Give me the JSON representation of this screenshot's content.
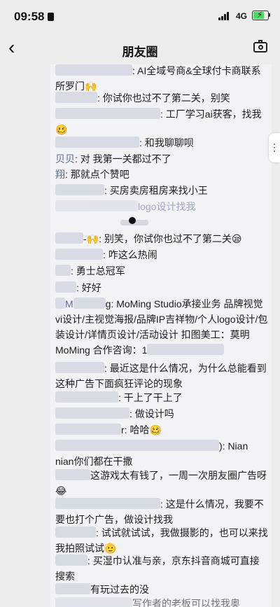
{
  "status_bar": {
    "time": "09:58",
    "network": "4G"
  },
  "nav": {
    "back_icon": "chevron-left",
    "title": "朋友圈",
    "camera_icon": "camera"
  },
  "comments": [
    {
      "author": "",
      "text": ": AI全域号商&全球付卡商联系所罗门🙌"
    },
    {
      "author": "",
      "text": ": 你试你也过不了第二关，别笑"
    },
    {
      "author": "",
      "text": ": 工厂学习ai获客，找我🥴"
    },
    {
      "author": "",
      "text": ": 和我聊聊呗"
    },
    {
      "author": "贝贝",
      "text": ": 对 我第一关都过不了"
    },
    {
      "author": "翔",
      "text": ": 那就点个赞吧"
    },
    {
      "author": "",
      "text": ": 买房卖房租房来找小王"
    },
    {
      "author": "",
      "text": "logo设计找我"
    },
    {
      "author": "",
      "text": "-🙌: 别笑，你试你也过不了第二关😪"
    },
    {
      "author": "",
      "text": ": 咋这么热闹"
    },
    {
      "author": "",
      "text": ": 勇士总冠军"
    },
    {
      "author": "",
      "text": ": 好好"
    },
    {
      "author": "M",
      "text": "g: MoMing Studio承接业务 品牌视觉vi设计/主视觉海报/品牌IP吉祥物/个人logo设计/包装设计/详情页设计/活动设计 扣图美工：莫明MoMing 合作咨询：1"
    },
    {
      "author": "",
      "text": ": 最近这是什么情况，为什么总能看到这种广告下面疯狂评论的现象"
    },
    {
      "author": "",
      "text": ": 干上了干上了"
    },
    {
      "author": "",
      "text": ": 做设计吗"
    },
    {
      "author": "",
      "text": "r: 哈哈🥴"
    },
    {
      "author": "",
      "text": "): Nian nian你们都在干撒"
    },
    {
      "author": "",
      "text": "这游戏太有钱了，一周一次朋友圈广告呀😂"
    },
    {
      "author": "",
      "text": ": 这是什么情况，我要不要也打个广告，做设计找我"
    },
    {
      "author": "",
      "text": ": 试试就试试，我做摄影的，也可以来找我拍照试试🫡"
    },
    {
      "author": "",
      "text": ": 买湿巾认准与亲，京东抖音商城可直接搜索"
    },
    {
      "author": "",
      "text": "有玩过去的没"
    },
    {
      "author": "",
      "text": "写作者的老板可以找我奥"
    }
  ]
}
